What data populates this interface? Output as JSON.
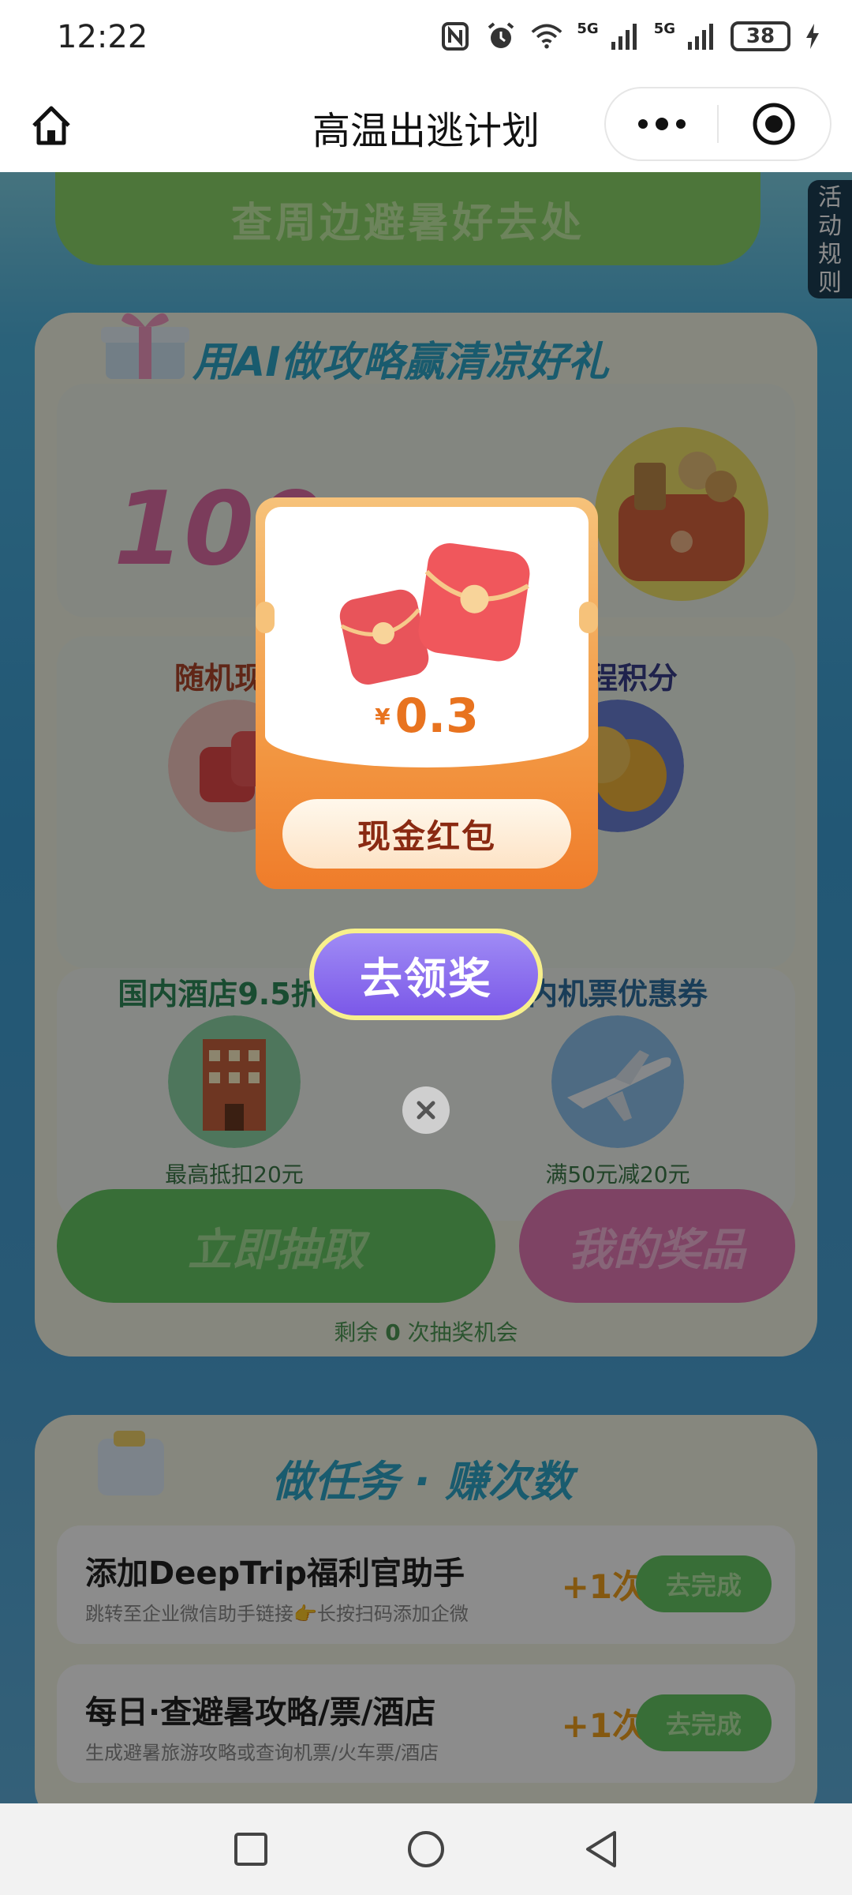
{
  "status_bar": {
    "time": "12:22",
    "signal1_label": "5G",
    "signal2_label": "5G",
    "battery": "38"
  },
  "nav": {
    "title": "高温出逃计划"
  },
  "page": {
    "top_button": "查周边避暑好去处",
    "rules_tab": "活动规则",
    "card1": {
      "title": "用AI做攻略赢清凉好礼",
      "banner_number": "100",
      "prizes": [
        {
          "label": "随机现金",
          "sub": ""
        },
        {
          "label": "里程积分",
          "sub": ""
        },
        {
          "label": "国内酒店9.5折优",
          "sub": "最高抵扣20元"
        },
        {
          "label": "内机票优惠券",
          "sub": "满50元减20元"
        }
      ],
      "draw_button": "立即抽取",
      "my_prizes_button": "我的奖品",
      "remain_prefix": "剩余",
      "remain_count": "0",
      "remain_suffix": "次抽奖机会"
    },
    "card2": {
      "title": "做任务 · 赚次数",
      "tasks": [
        {
          "title": "添加DeepTrip福利官助手",
          "desc": "跳转至企业微信助手链接👉长按扫码添加企微",
          "reward": "+1次",
          "button": "去完成"
        },
        {
          "title": "每日·查避暑攻略/票/酒店",
          "desc": "生成避暑旅游攻略或查询机票/火车票/酒店",
          "reward": "+1次",
          "button": "去完成"
        }
      ]
    }
  },
  "modal": {
    "currency": "¥",
    "amount": "0.3",
    "label": "现金红包",
    "claim_button": "去领奖"
  },
  "colors": {
    "green_button": "#66c865",
    "pink_button": "#e67bb7",
    "claim_purple": "#7b58e8",
    "amount_orange": "#e8731f"
  }
}
